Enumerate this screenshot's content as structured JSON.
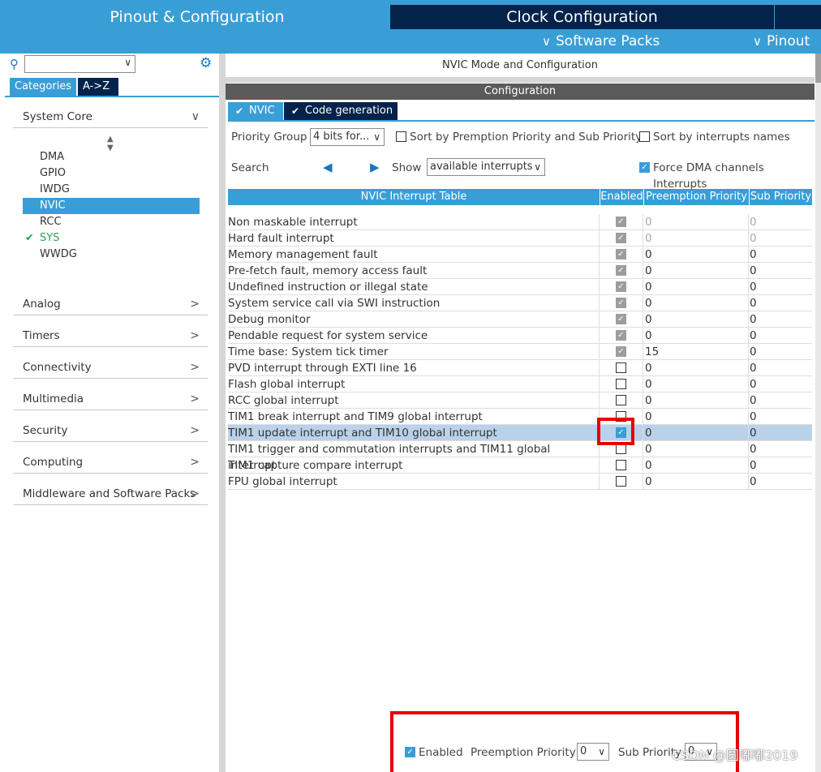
{
  "header": {
    "tab_pinout": "Pinout & Configuration",
    "tab_clock": "Clock Configuration",
    "menu_software_packs": "Software Packs",
    "menu_pinout": "Pinout"
  },
  "sidebar": {
    "tab_categories": "Categories",
    "tab_az": "A->Z",
    "sections": {
      "system_core": "System Core",
      "analog": "Analog",
      "timers": "Timers",
      "connectivity": "Connectivity",
      "multimedia": "Multimedia",
      "security": "Security",
      "computing": "Computing",
      "middleware": "Middleware and Software Packs"
    },
    "system_core_items": [
      "DMA",
      "GPIO",
      "IWDG",
      "NVIC",
      "RCC",
      "SYS",
      "WWDG"
    ]
  },
  "main": {
    "title": "NVIC Mode and Configuration",
    "config_title": "Configuration",
    "tab_nvic": "NVIC",
    "tab_codegen": "Code generation",
    "priority_group_label": "Priority Group",
    "priority_group_value": "4 bits for...",
    "sort_premption_label": "Sort by Premption Priority and Sub Priority",
    "sort_names_label": "Sort by interrupts names",
    "search_label": "Search",
    "show_label": "Show",
    "show_value": "available interrupts",
    "force_dma_label": "Force DMA channels Interrupts"
  },
  "table": {
    "headers": {
      "name": "NVIC Interrupt Table",
      "enabled": "Enabled",
      "preemption": "Preemption Priority",
      "sub": "Sub Priority"
    },
    "rows": [
      {
        "name": "Non maskable interrupt",
        "pp": "0",
        "sp": "0"
      },
      {
        "name": "Hard fault interrupt",
        "pp": "0",
        "sp": "0"
      },
      {
        "name": "Memory management fault",
        "pp": "0",
        "sp": "0"
      },
      {
        "name": "Pre-fetch fault, memory access fault",
        "pp": "0",
        "sp": "0"
      },
      {
        "name": "Undefined instruction or illegal state",
        "pp": "0",
        "sp": "0"
      },
      {
        "name": "System service call via SWI instruction",
        "pp": "0",
        "sp": "0"
      },
      {
        "name": "Debug monitor",
        "pp": "0",
        "sp": "0"
      },
      {
        "name": "Pendable request for system service",
        "pp": "0",
        "sp": "0"
      },
      {
        "name": "Time base: System tick timer",
        "pp": "15",
        "sp": "0"
      },
      {
        "name": "PVD interrupt through EXTI line 16",
        "pp": "0",
        "sp": "0"
      },
      {
        "name": "Flash global interrupt",
        "pp": "0",
        "sp": "0"
      },
      {
        "name": "RCC global interrupt",
        "pp": "0",
        "sp": "0"
      },
      {
        "name": "TIM1 break interrupt and TIM9 global interrupt",
        "pp": "0",
        "sp": "0"
      },
      {
        "name": "TIM1 update interrupt and TIM10 global interrupt",
        "pp": "0",
        "sp": "0"
      },
      {
        "name": "TIM1 trigger and commutation interrupts and TIM11 global interrupt",
        "pp": "0",
        "sp": "0"
      },
      {
        "name": "TIM1 capture compare interrupt",
        "pp": "0",
        "sp": "0"
      },
      {
        "name": "FPU global interrupt",
        "pp": "0",
        "sp": "0"
      }
    ]
  },
  "bottom": {
    "enabled_label": "Enabled",
    "preemption_label": "Preemption Priority",
    "preemption_value": "0",
    "sub_label": "Sub Priority",
    "sub_value": "0"
  },
  "watermark": "CSDN @圆嘟嘟2019",
  "colors": {
    "accent": "#3a9ed6",
    "dark": "#03234b",
    "highlight": "#e60000"
  }
}
